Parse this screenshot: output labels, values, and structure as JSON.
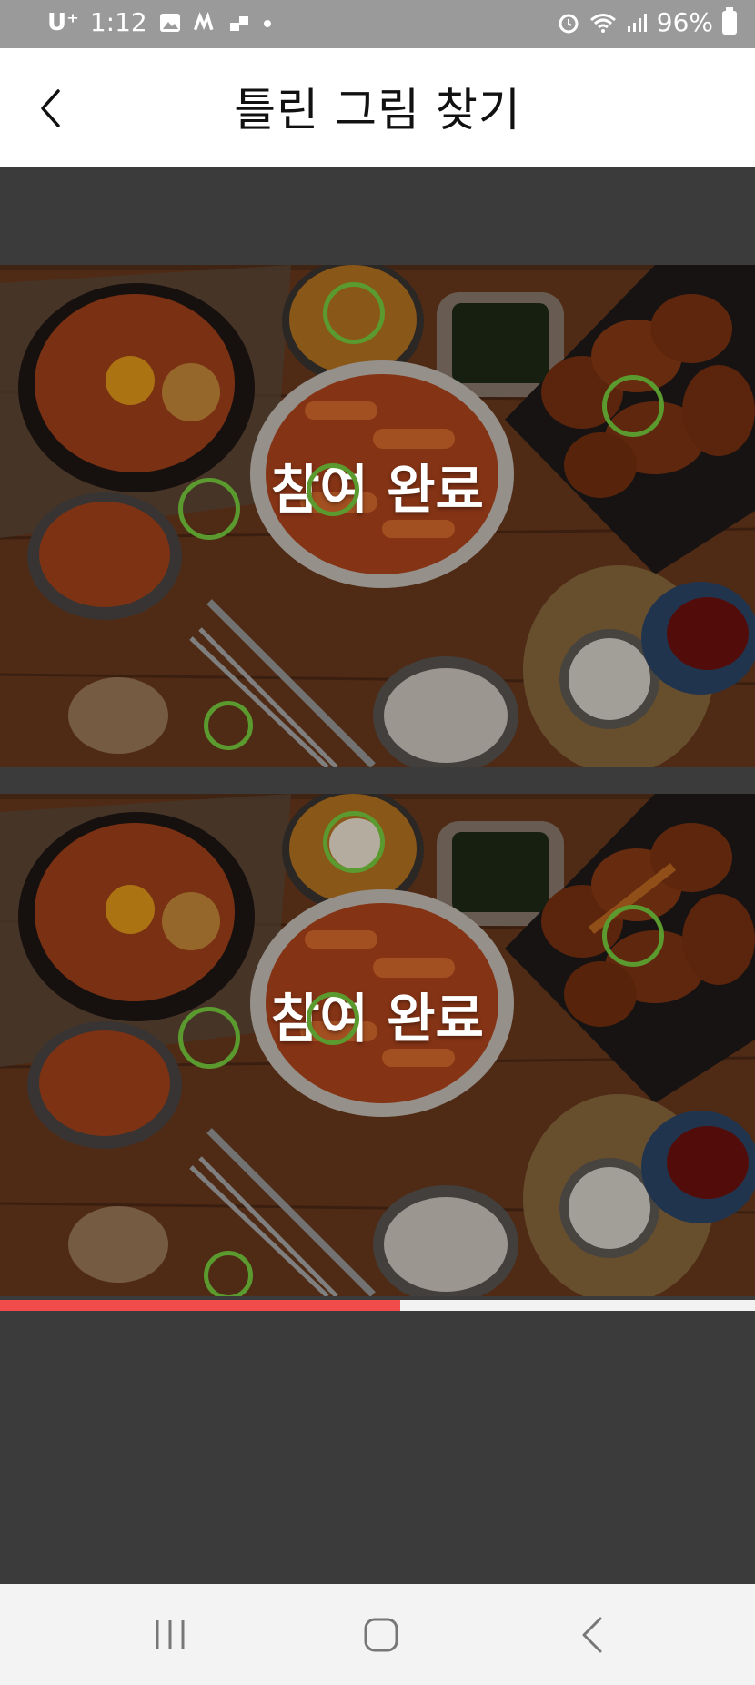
{
  "status_bar": {
    "carrier": "U⁺",
    "time": "1:12",
    "battery": "96%",
    "icons": [
      "gallery-icon",
      "m-app-icon",
      "sync-icon",
      "dot-icon",
      "alarm-icon",
      "wifi-icon",
      "signal-icon",
      "battery-icon"
    ]
  },
  "header": {
    "title": "틀린 그림 찾기",
    "back_icon": "chevron-left-icon"
  },
  "game": {
    "top_image": {
      "overlay": "참여 완료"
    },
    "bottom_image": {
      "overlay": "참여 완료"
    },
    "marker_color": "#5a9a2e"
  },
  "progress": {
    "value": 0.53,
    "fill_color": "#f24b4b"
  },
  "nav_bar": {
    "icons": [
      "recent-apps-icon",
      "home-icon",
      "back-icon"
    ]
  }
}
